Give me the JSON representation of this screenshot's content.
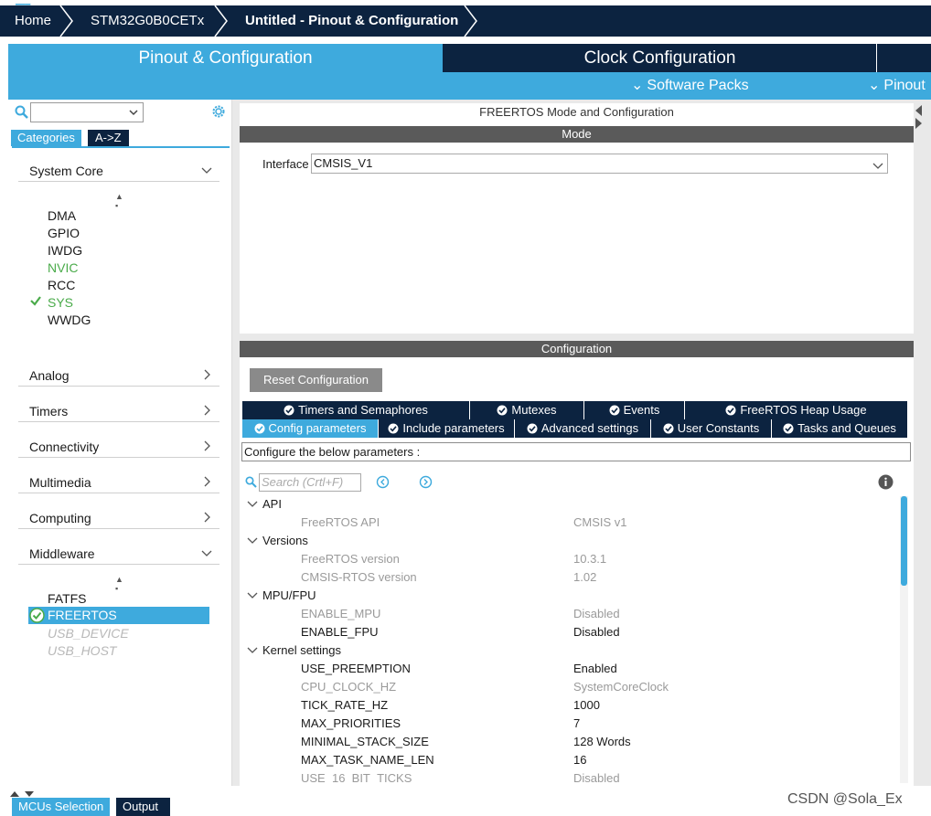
{
  "breadcrumb": {
    "home": "Home",
    "device": "STM32G0B0CETx",
    "project": "Untitled - Pinout & Configuration"
  },
  "tabs": {
    "pinout": "Pinout & Configuration",
    "clock": "Clock Configuration"
  },
  "subbar": {
    "software_packs": "Software Packs",
    "pinout": "Pinout"
  },
  "left": {
    "categories_tab": "Categories",
    "az_tab": "A->Z",
    "system_core": "System Core",
    "system_core_items": [
      "DMA",
      "GPIO",
      "IWDG",
      "NVIC",
      "RCC",
      "SYS",
      "WWDG"
    ],
    "analog": "Analog",
    "timers": "Timers",
    "connectivity": "Connectivity",
    "multimedia": "Multimedia",
    "computing": "Computing",
    "middleware": "Middleware",
    "middleware_items": [
      "FATFS",
      "FREERTOS",
      "USB_DEVICE",
      "USB_HOST"
    ]
  },
  "mode": {
    "panel_title": "FREERTOS Mode and Configuration",
    "section": "Mode",
    "interface_label": "Interface",
    "interface_value": "CMSIS_V1"
  },
  "configuration": {
    "section": "Configuration",
    "reset_button": "Reset Configuration",
    "tabs_row1": [
      "Timers and Semaphores",
      "Mutexes",
      "Events",
      "FreeRTOS Heap Usage"
    ],
    "tabs_row2": [
      "Config parameters",
      "Include parameters",
      "Advanced settings",
      "User Constants",
      "Tasks and Queues"
    ],
    "hint": "Configure the below parameters :",
    "search_placeholder": "Search (Crtl+F)",
    "groups": {
      "api": "API",
      "versions": "Versions",
      "mpu": "MPU/FPU",
      "kernel": "Kernel settings"
    },
    "params": [
      {
        "name": "FreeRTOS API",
        "value": "CMSIS v1"
      },
      {
        "name": "FreeRTOS version",
        "value": "10.3.1"
      },
      {
        "name": "CMSIS-RTOS version",
        "value": "1.02"
      },
      {
        "name": "ENABLE_MPU",
        "value": "Disabled"
      },
      {
        "name": "ENABLE_FPU",
        "value": "Disabled"
      },
      {
        "name": "USE_PREEMPTION",
        "value": "Enabled"
      },
      {
        "name": "CPU_CLOCK_HZ",
        "value": "SystemCoreClock"
      },
      {
        "name": "TICK_RATE_HZ",
        "value": "1000"
      },
      {
        "name": "MAX_PRIORITIES",
        "value": "7"
      },
      {
        "name": "MINIMAL_STACK_SIZE",
        "value": "128 Words"
      },
      {
        "name": "MAX_TASK_NAME_LEN",
        "value": "16"
      },
      {
        "name": "USE_16_BIT_TICKS",
        "value": "Disabled"
      }
    ]
  },
  "bottom": {
    "mcu_tab": "MCUs Selection",
    "output_tab": "Output"
  },
  "watermark": "CSDN @Sola_Ex",
  "colors": {
    "navy": "#0c2340",
    "accent": "#3eaadd",
    "green": "#4aab4a"
  },
  "icons": [
    "search-icon",
    "gear-icon",
    "chevron-down-icon",
    "chevron-right-icon",
    "check-icon",
    "info-icon"
  ]
}
